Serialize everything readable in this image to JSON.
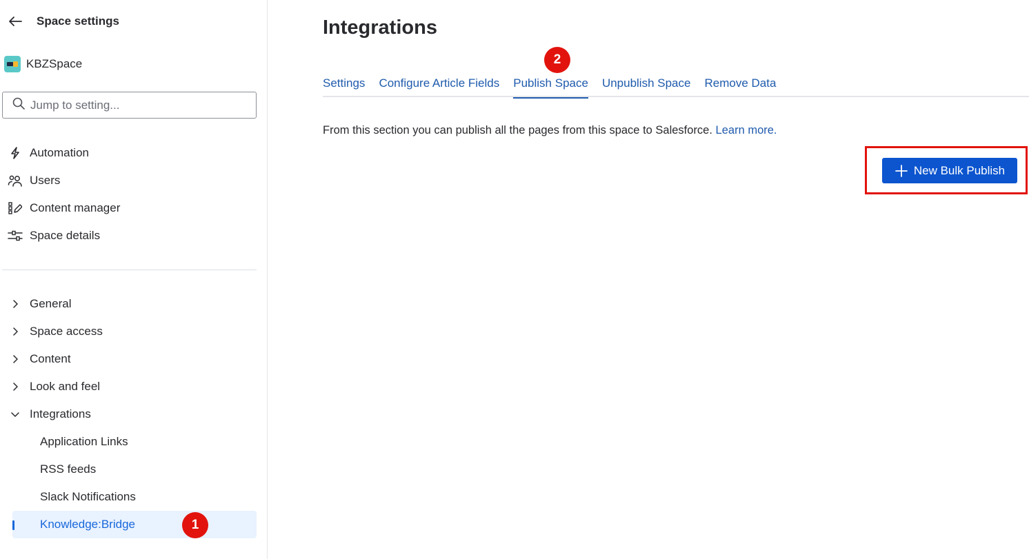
{
  "sidebar": {
    "title": "Space settings",
    "space_name": "KBZSpace",
    "search_placeholder": "Jump to setting...",
    "top_items": [
      {
        "label": "Automation",
        "icon": "lightning-icon"
      },
      {
        "label": "Users",
        "icon": "users-icon"
      },
      {
        "label": "Content manager",
        "icon": "content-manager-icon"
      },
      {
        "label": "Space details",
        "icon": "sliders-icon"
      }
    ],
    "tree": [
      {
        "label": "General",
        "expanded": false
      },
      {
        "label": "Space access",
        "expanded": false
      },
      {
        "label": "Content",
        "expanded": false
      },
      {
        "label": "Look and feel",
        "expanded": false
      },
      {
        "label": "Integrations",
        "expanded": true
      }
    ],
    "sub_items": [
      {
        "label": "Application Links"
      },
      {
        "label": "RSS feeds"
      },
      {
        "label": "Slack Notifications"
      },
      {
        "label": "Knowledge:Bridge",
        "active": true
      }
    ],
    "step_badge": "1"
  },
  "main": {
    "title": "Integrations",
    "tabs": [
      {
        "label": "Settings"
      },
      {
        "label": "Configure Article Fields"
      },
      {
        "label": "Publish Space",
        "active": true
      },
      {
        "label": "Unpublish Space"
      },
      {
        "label": "Remove Data"
      }
    ],
    "step_badge": "2",
    "description": "From this section you can publish all the pages from this space to Salesforce.",
    "learn_more": "Learn more.",
    "primary_button": "New Bulk Publish"
  },
  "colors": {
    "accent": "#1868DB",
    "link": "#1F5BAD",
    "button": "#0C55CF",
    "annotation": "#E2130D",
    "active_bg": "#E9F2FF"
  }
}
